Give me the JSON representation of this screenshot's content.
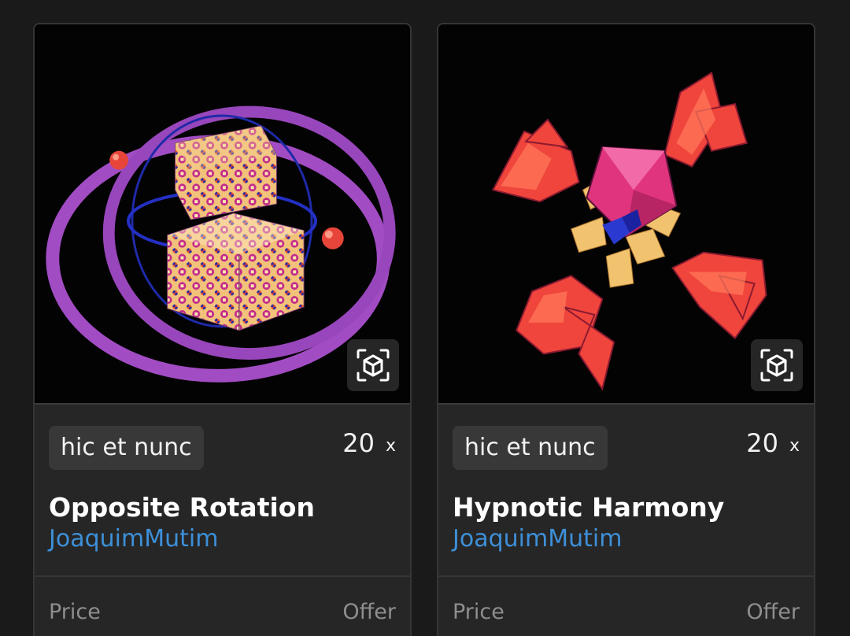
{
  "cards": [
    {
      "platform": "hic et nunc",
      "editions": "20",
      "editions_suffix": "x",
      "title": "Opposite Rotation",
      "artist": "JoaquimMutim",
      "price_label": "Price",
      "offer_label": "Offer",
      "ar_icon": "ar-cube-icon"
    },
    {
      "platform": "hic et nunc",
      "editions": "20",
      "editions_suffix": "x",
      "title": "Hypnotic Harmony",
      "artist": "JoaquimMutim",
      "price_label": "Price",
      "offer_label": "Offer",
      "ar_icon": "ar-cube-icon"
    }
  ],
  "colors": {
    "background": "#1a1a1a",
    "card": "#262626",
    "link": "#3d8fd8",
    "muted": "#8e8e8e"
  }
}
